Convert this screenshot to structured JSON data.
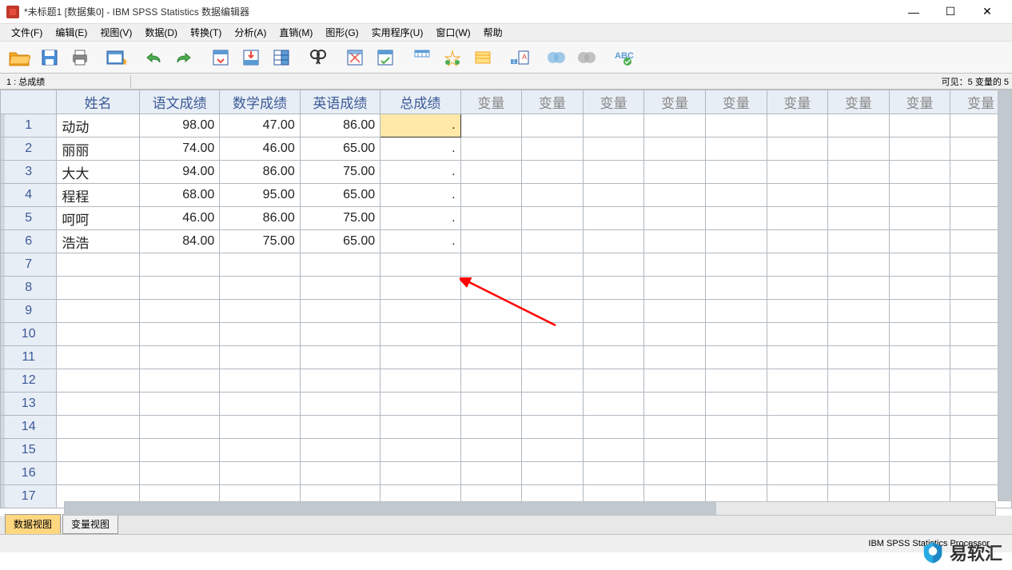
{
  "window": {
    "title": "*未标题1 [数据集0] - IBM SPSS Statistics 数据编辑器",
    "min": "—",
    "max": "☐",
    "close": "✕"
  },
  "menu": {
    "file": "文件(F)",
    "edit": "编辑(E)",
    "view": "视图(V)",
    "data": "数据(D)",
    "transform": "转换(T)",
    "analyze": "分析(A)",
    "direct": "直销(M)",
    "graphs": "图形(G)",
    "utilities": "实用程序(U)",
    "window": "窗口(W)",
    "help": "帮助"
  },
  "infobar": {
    "cell": "1 : 总成绩",
    "visible": "可见：5 变量的 5"
  },
  "columns": {
    "c0": "姓名",
    "c1": "语文成绩",
    "c2": "数学成绩",
    "c3": "英语成绩",
    "c4": "总成绩",
    "var": "变量"
  },
  "rows": [
    {
      "n": "1",
      "name": "动动",
      "a": "98.00",
      "b": "47.00",
      "c": "86.00",
      "d": "."
    },
    {
      "n": "2",
      "name": "丽丽",
      "a": "74.00",
      "b": "46.00",
      "c": "65.00",
      "d": "."
    },
    {
      "n": "3",
      "name": "大大",
      "a": "94.00",
      "b": "86.00",
      "c": "75.00",
      "d": "."
    },
    {
      "n": "4",
      "name": "程程",
      "a": "68.00",
      "b": "95.00",
      "c": "65.00",
      "d": "."
    },
    {
      "n": "5",
      "name": "呵呵",
      "a": "46.00",
      "b": "86.00",
      "c": "75.00",
      "d": "."
    },
    {
      "n": "6",
      "name": "浩浩",
      "a": "84.00",
      "b": "75.00",
      "c": "65.00",
      "d": "."
    }
  ],
  "empty_rows": [
    "7",
    "8",
    "9",
    "10",
    "11",
    "12",
    "13",
    "14",
    "15",
    "16",
    "17"
  ],
  "tabs": {
    "data": "数据视图",
    "var": "变量视图"
  },
  "status": {
    "processor": "IBM SPSS Statistics Processor"
  },
  "watermark": "易软汇"
}
